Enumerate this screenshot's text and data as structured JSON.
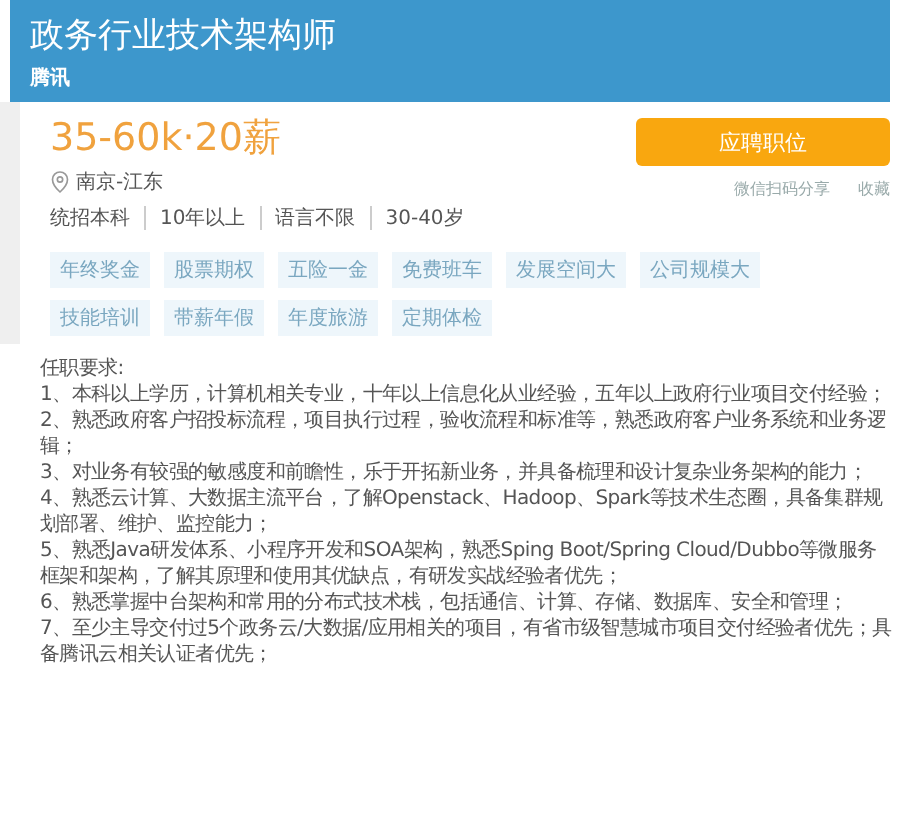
{
  "header": {
    "title": "政务行业技术架构师",
    "company": "腾讯"
  },
  "salary": "35-60k·20薪",
  "apply_button": "应聘职位",
  "links": [
    "微信扫码分享",
    "收藏"
  ],
  "location": "南京-江东",
  "requirements_summary": [
    "统招本科",
    "10年以上",
    "语言不限",
    "30-40岁"
  ],
  "benefit_tags": [
    "年终奖金",
    "股票期权",
    "五险一金",
    "免费班车",
    "发展空间大",
    "公司规模大",
    "技能培训",
    "带薪年假",
    "年度旅游",
    "定期体检"
  ],
  "description": {
    "heading": "任职要求:",
    "items": [
      "1、本科以上学历，计算机相关专业，十年以上信息化从业经验，五年以上政府行业项目交付经验；",
      "2、熟悉政府客户招投标流程，项目执行过程，验收流程和标准等，熟悉政府客户业务系统和业务逻辑；",
      "3、对业务有较强的敏感度和前瞻性，乐于开拓新业务，并具备梳理和设计复杂业务架构的能力；",
      "4、熟悉云计算、大数据主流平台，了解Openstack、Hadoop、Spark等技术生态圈，具备集群规划部署、维护、监控能力；",
      "5、熟悉Java研发体系、小程序开发和SOA架构，熟悉Sping Boot/Spring Cloud/Dubbo等微服务框架和架构，了解其原理和使用其优缺点，有研发实战经验者优先；",
      "6、熟悉掌握中台架构和常用的分布式技术栈，包括通信、计算、存储、数据库、安全和管理；",
      "7、至少主导交付过5个政务云/大数据/应用相关的项目，有省市级智慧城市项目交付经验者优先；具备腾讯云相关认证者优先；"
    ]
  }
}
